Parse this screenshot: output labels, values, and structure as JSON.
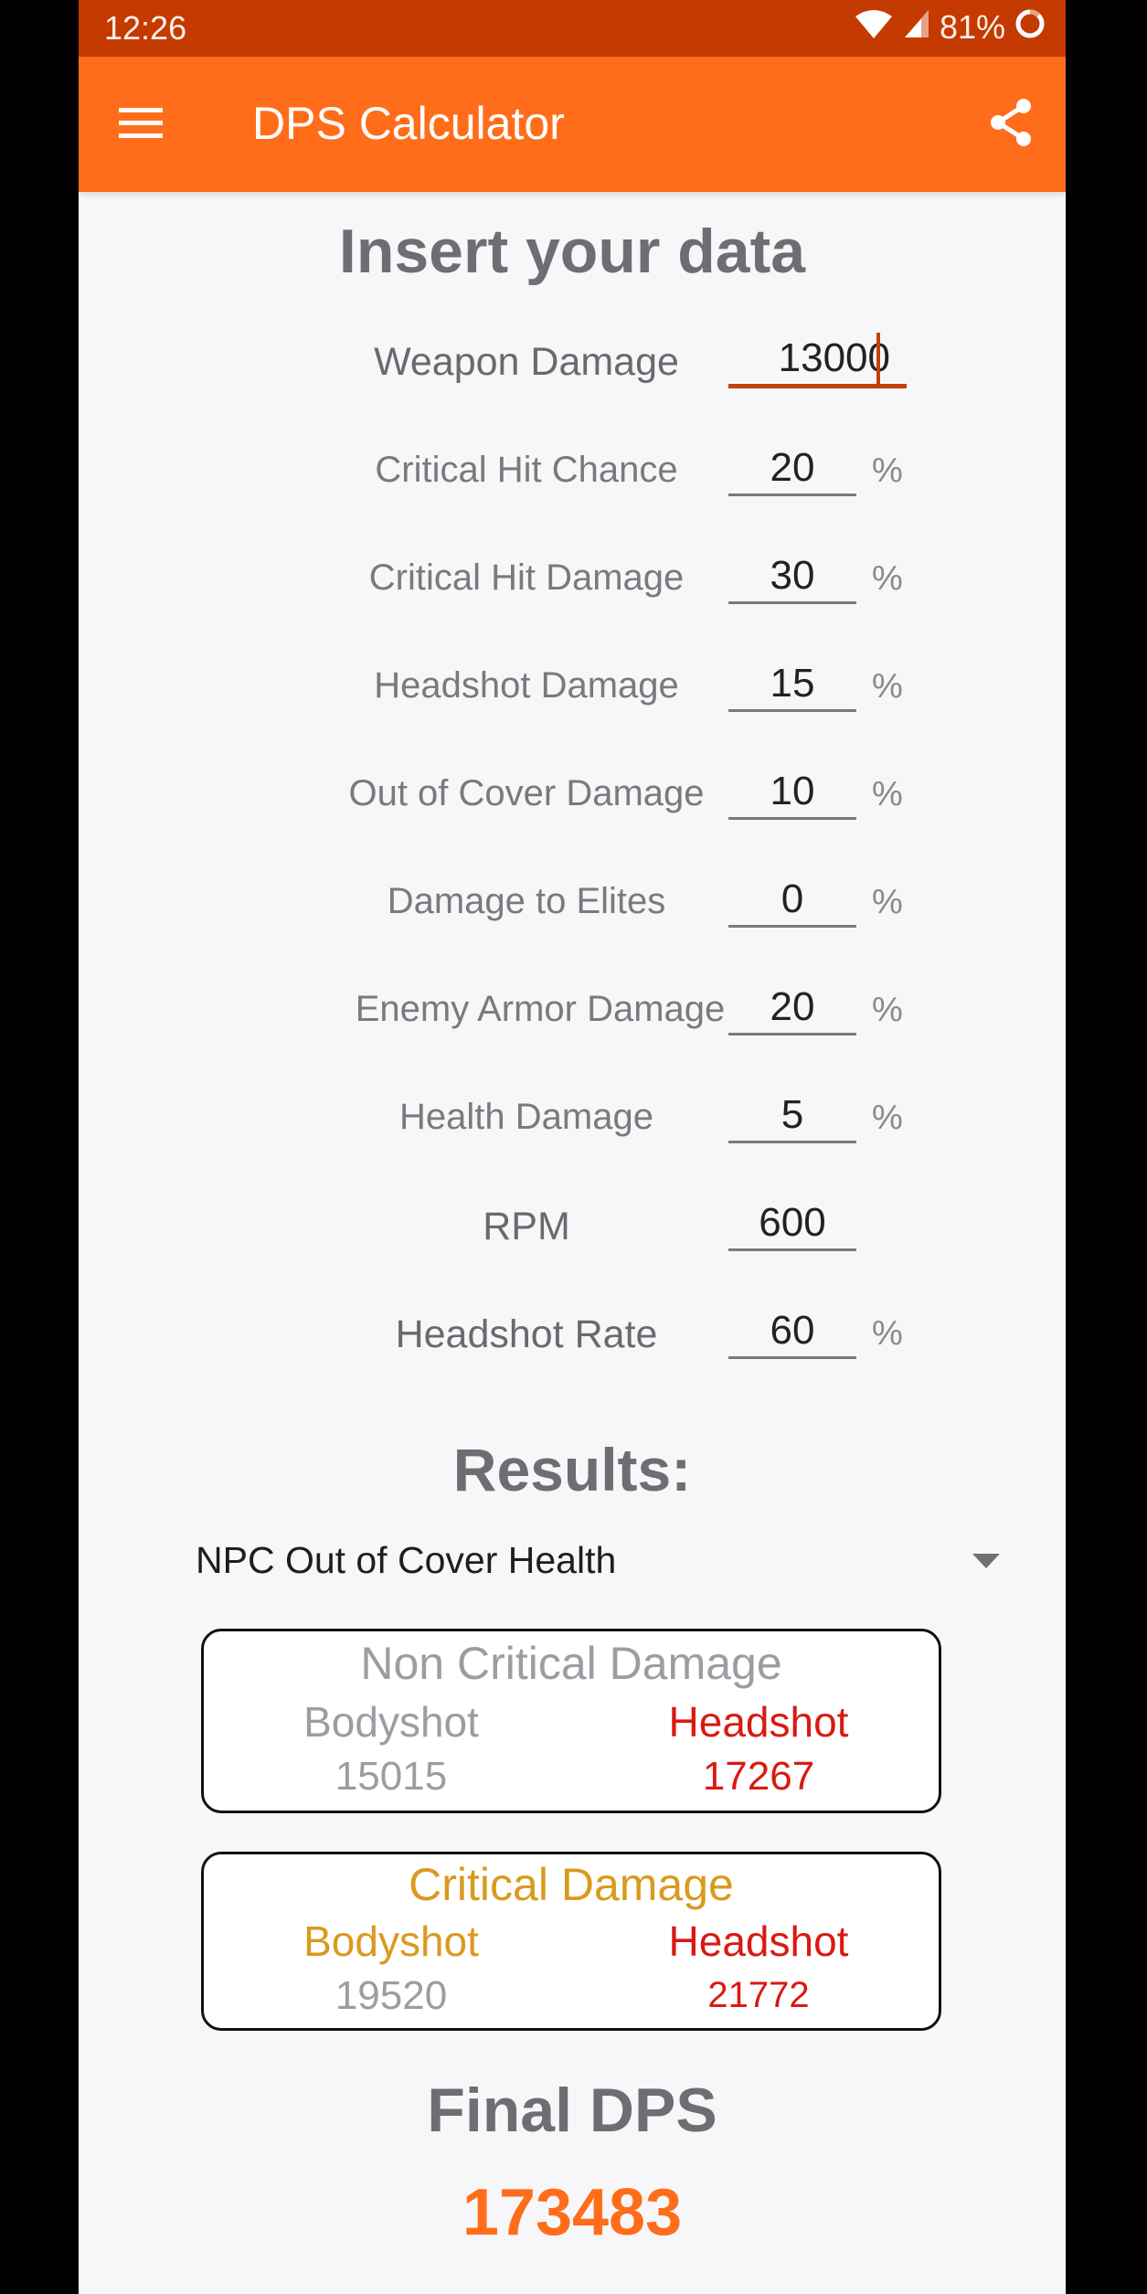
{
  "status_bar": {
    "time": "12:26",
    "battery": "81%",
    "icons": [
      "wifi-icon",
      "cell-signal-icon",
      "battery-ring-icon"
    ]
  },
  "toolbar": {
    "title": "DPS Calculator",
    "menu_icon": "hamburger-menu-icon",
    "share_icon": "share-icon"
  },
  "form": {
    "title": "Insert your data",
    "fields": [
      {
        "label": "Weapon Damage",
        "value": "13000",
        "unit": "",
        "focused": true
      },
      {
        "label": "Critical Hit Chance",
        "value": "20",
        "unit": "%"
      },
      {
        "label": "Critical Hit Damage",
        "value": "30",
        "unit": "%"
      },
      {
        "label": "Headshot Damage",
        "value": "15",
        "unit": "%"
      },
      {
        "label": "Out of Cover Damage",
        "value": "10",
        "unit": "%"
      },
      {
        "label": "Damage to Elites",
        "value": "0",
        "unit": "%"
      },
      {
        "label": "Enemy Armor Damage",
        "value": "20",
        "unit": "%"
      },
      {
        "label": "Health Damage",
        "value": "5",
        "unit": "%"
      },
      {
        "label": "RPM",
        "value": "600",
        "unit": ""
      },
      {
        "label": "Headshot Rate",
        "value": "60",
        "unit": "%"
      }
    ]
  },
  "results": {
    "title": "Results:",
    "target_select": {
      "selected": "NPC Out of Cover Health"
    },
    "non_critical": {
      "title": "Non Critical Damage",
      "bodyshot_label": "Bodyshot",
      "headshot_label": "Headshot",
      "bodyshot_value": "15015",
      "headshot_value": "17267"
    },
    "critical": {
      "title": "Critical Damage",
      "bodyshot_label": "Bodyshot",
      "headshot_label": "Headshot",
      "bodyshot_value": "19520",
      "headshot_value": "21772"
    },
    "final_dps_label": "Final DPS",
    "final_dps_value": "173483"
  },
  "colors": {
    "status_bar": "#c43a00",
    "toolbar": "#ff6d1a",
    "accent": "#c2410c",
    "non_critical_title": "#9a9ea2",
    "critical_title": "#d99a1e",
    "headshot": "#d91a12",
    "final_dps": "#ff6d1a"
  }
}
